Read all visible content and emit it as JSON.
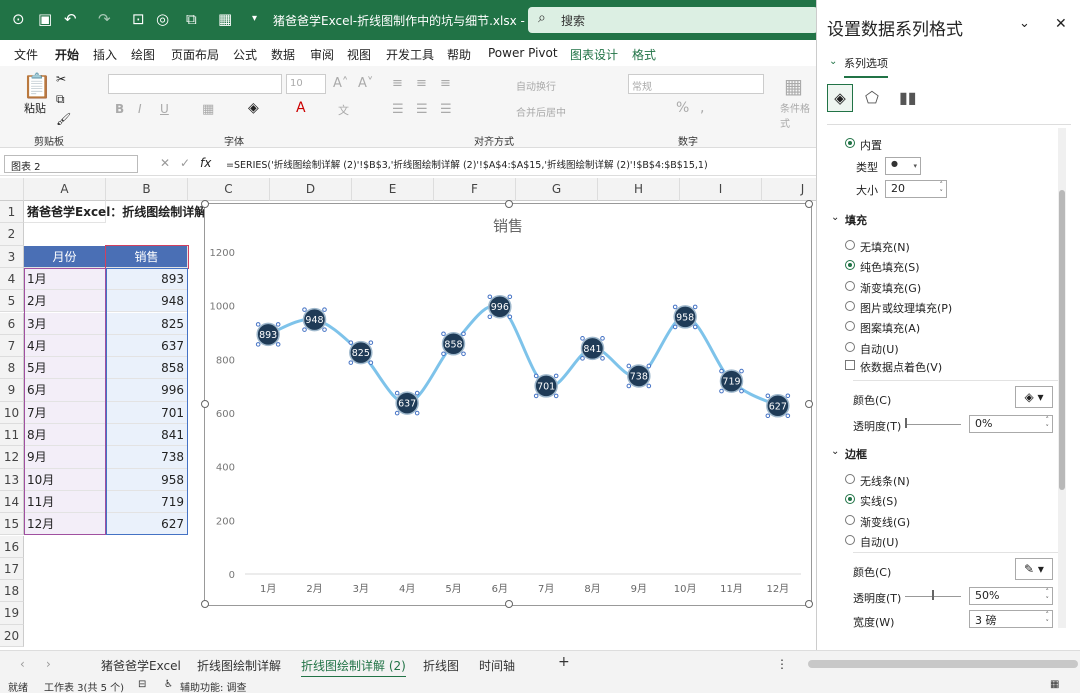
{
  "titlebar": {
    "title": "猪爸爸学Excel-折线图制作中的坑与细节.xlsx - Ex...",
    "search_placeholder": "搜索"
  },
  "menu": {
    "items": [
      "文件",
      "开始",
      "插入",
      "绘图",
      "页面布局",
      "公式",
      "数据",
      "审阅",
      "视图",
      "开发工具",
      "帮助",
      "Power Pivot",
      "图表设计",
      "格式"
    ],
    "active": "开始"
  },
  "ribbon": {
    "paste": "粘贴",
    "clipboard": "剪贴板",
    "font": "字体",
    "font_size": "10",
    "alignment": "对齐方式",
    "wrap_text": "自动换行",
    "merge_center": "合并后居中",
    "number": "数字",
    "number_format": "常规",
    "cond_format": "条件格式"
  },
  "formula_bar": {
    "name_box": "图表 2",
    "fx": "fx",
    "formula": "=SERIES('折线图绘制详解 (2)'!$B$3,'折线图绘制详解 (2)'!$A$4:$A$15,'折线图绘制详解 (2)'!$B$4:$B$15,1)"
  },
  "columns": [
    "A",
    "B",
    "C",
    "D",
    "E",
    "F",
    "G",
    "H",
    "I",
    "J"
  ],
  "rows": [
    "1",
    "2",
    "3",
    "4",
    "5",
    "6",
    "7",
    "8",
    "9",
    "10",
    "11",
    "12",
    "13",
    "14",
    "15",
    "16",
    "17",
    "18",
    "19",
    "20"
  ],
  "sheet": {
    "a1": "猪爸爸学Excel：折线图绘制详解",
    "header_month": "月份",
    "header_sales": "销售",
    "months": [
      "1月",
      "2月",
      "3月",
      "4月",
      "5月",
      "6月",
      "7月",
      "8月",
      "9月",
      "10月",
      "11月",
      "12月"
    ],
    "sales": [
      893,
      948,
      825,
      637,
      858,
      996,
      701,
      841,
      738,
      958,
      719,
      627
    ]
  },
  "chart_data": {
    "type": "line",
    "title": "销售",
    "categories": [
      "1月",
      "2月",
      "3月",
      "4月",
      "5月",
      "6月",
      "7月",
      "8月",
      "9月",
      "10月",
      "11月",
      "12月"
    ],
    "series": [
      {
        "values": [
          893,
          948,
          825,
          637,
          858,
          996,
          701,
          841,
          738,
          958,
          719,
          627
        ]
      }
    ],
    "ylim": [
      0,
      1200
    ],
    "yticks": [
      "0",
      "200",
      "400",
      "600",
      "800",
      "1000",
      "1200"
    ],
    "smooth": true,
    "data_labels": "inside marker",
    "grid": false,
    "line_color": "#7ec3ea",
    "marker_color": "#1f3b57"
  },
  "sheet_tabs": {
    "tabs": [
      "猪爸爸学Excel",
      "折线图绘制详解",
      "折线图绘制详解 (2)",
      "折线图",
      "时间轴"
    ],
    "active": "折线图绘制详解 (2)",
    "add": "+"
  },
  "status": {
    "ready": "就绪",
    "sheet_info": "工作表 3(共 5 个)",
    "accessibility": "辅助功能: 调查"
  },
  "format_pane": {
    "title": "设置数据系列格式",
    "tab": "系列选项",
    "builtin": "内置",
    "type_label": "类型",
    "type_value": "●",
    "size_label": "大小",
    "size_value": "20",
    "fill_section": "填充",
    "fill_options": [
      "无填充(N)",
      "纯色填充(S)",
      "渐变填充(G)",
      "图片或纹理填充(P)",
      "图案填充(A)",
      "自动(U)"
    ],
    "vary_colors": "依数据点着色(V)",
    "color_label": "颜色(C)",
    "transparency_label": "透明度(T)",
    "fill_transparency": "0%",
    "border_section": "边框",
    "border_options": [
      "无线条(N)",
      "实线(S)",
      "渐变线(G)",
      "自动(U)"
    ],
    "border_color_label": "颜色(C)",
    "border_transparency_label": "透明度(T)",
    "border_transparency": "50%",
    "width_label": "宽度(W)",
    "width_value": "3 磅"
  }
}
